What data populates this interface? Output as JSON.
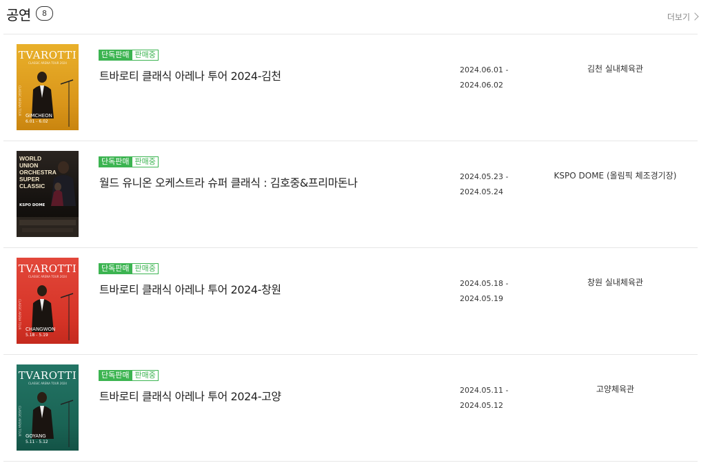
{
  "header": {
    "title": "공연",
    "count": "8",
    "more_label": "더보기",
    "more_icon": "chevron-right-icon"
  },
  "badges": {
    "exclusive": "단독판매",
    "on_sale": "판매중"
  },
  "colors": {
    "badge_green": "#3cb451"
  },
  "items": [
    {
      "name": "트바로티 클래식 아레나 투어 2024-김천",
      "date_start": "2024.06.01 -",
      "date_end": "2024.06.02",
      "venue": "김천 실내체육관",
      "poster": {
        "title": "TVAROTTI",
        "subtitle": "CLASSIC ARENA TOUR 2024",
        "city": "GIMCHEON",
        "dates": "6.01 - 6.02",
        "side": "CLASSIC ARENA TOUR",
        "bg": "#e3a31c"
      }
    },
    {
      "name": "월드 유니온 오케스트라 슈퍼 클래식 : 김호중&프리마돈나",
      "date_start": "2024.05.23 -",
      "date_end": "2024.05.24",
      "venue": "KSPO DOME (올림픽 체조경기장)",
      "poster": {
        "title": "WORLD UNION\nORCHESTRA\nSUPER\nCLASSIC",
        "city": "KSPO DOME",
        "bg": "#1a1714"
      }
    },
    {
      "name": "트바로티 클래식 아레나 투어 2024-창원",
      "date_start": "2024.05.18 -",
      "date_end": "2024.05.19",
      "venue": "창원 실내체육관",
      "poster": {
        "title": "TVAROTTI",
        "subtitle": "CLASSIC ARENA TOUR 2024",
        "city": "CHANGWON",
        "dates": "5.18 - 5.19",
        "side": "CLASSIC ARENA TOUR",
        "bg": "#dc3a2c"
      }
    },
    {
      "name": "트바로티 클래식 아레나 투어 2024-고양",
      "date_start": "2024.05.11 -",
      "date_end": "2024.05.12",
      "venue": "고양체육관",
      "poster": {
        "title": "TVAROTTI",
        "subtitle": "CLASSIC ARENA TOUR 2024",
        "city": "GOYANG",
        "dates": "5.11 - 5.12",
        "side": "CLASSIC ARENA TOUR",
        "bg": "#1d6a5d"
      }
    }
  ]
}
